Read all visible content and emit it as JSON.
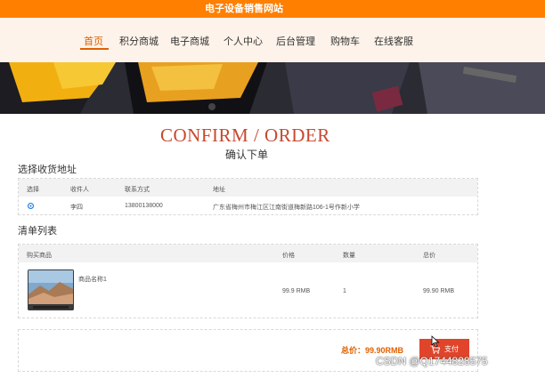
{
  "header": {
    "site_title": "电子设备销售网站"
  },
  "nav": {
    "items": [
      {
        "label": "首页",
        "active": true
      },
      {
        "label": "积分商城",
        "active": false
      },
      {
        "label": "电子商城",
        "active": false
      },
      {
        "label": "个人中心",
        "active": false
      },
      {
        "label": "后台管理",
        "active": false
      },
      {
        "label": "购物车",
        "active": false
      },
      {
        "label": "在线客服",
        "active": false
      }
    ]
  },
  "page": {
    "title": "CONFIRM / ORDER",
    "subtitle": "确认下单"
  },
  "address_section": {
    "title": "选择收货地址",
    "columns": [
      "选择",
      "收件人",
      "联系方式",
      "地址"
    ],
    "rows": [
      {
        "selected": true,
        "recipient": "李四",
        "phone": "13800138000",
        "address": "广东省梅州市梅江区江南街道梅新路106-1号作新小学"
      }
    ]
  },
  "order_section": {
    "title": "清单列表",
    "columns": [
      "购买商品",
      "价格",
      "数量",
      "总价"
    ],
    "rows": [
      {
        "product_name": "商品名称1",
        "price": "99.9 RMB",
        "quantity": "1",
        "total": "99.90 RMB"
      }
    ]
  },
  "summary": {
    "total_text": "总价：99.90RMB",
    "pay_button": "支付"
  },
  "watermark": "CSDN @Q1744828575",
  "colors": {
    "accent": "#ff7f00",
    "title_red": "#c8482e",
    "pay_button": "#e0452b",
    "total_text": "#e06000"
  },
  "icons": {
    "pay_icon": "cart-icon"
  }
}
